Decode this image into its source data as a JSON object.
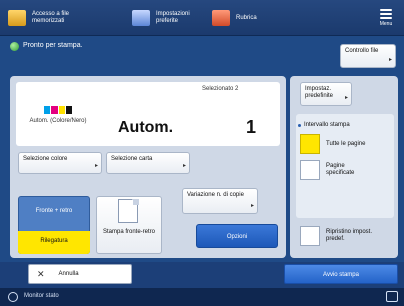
{
  "topbar": {
    "access_label": "Accesso a file memorizzati",
    "prefs_label": "Impostazioni preferite",
    "address_label": "Rubrica",
    "menu_label": "Menu"
  },
  "status": {
    "ready_text": "Pronto per stampa."
  },
  "controls": {
    "controllo_file": "Controllo file",
    "impost_predef": "Impostaz. predefinite",
    "selected_label": "Selezionato 2",
    "color_caption": "Autom. (Colore/Nero)",
    "color_mode_value": "Autom.",
    "copies_value": "1",
    "selezione_colore": "Selezione colore",
    "selezione_carta": "Selezione carta",
    "fronte_retro_top": "Fronte + retro",
    "fronte_retro_bottom": "Rilegatura",
    "stampa_fronte_retro": "Stampa fronte-retro",
    "variazione_copie": "Variazione n. di copie",
    "opzioni": "Opzioni"
  },
  "page_range": {
    "heading": "Intervallo stampa",
    "all_pages": "Tutte le pagine",
    "specified_pages": "Pagine specificate",
    "reset_defaults": "Ripristino impost. predef."
  },
  "bottom": {
    "annulla": "Annulla",
    "avvio_stampa": "Avvio stampa",
    "monitor": "Monitor stato"
  },
  "colors": {
    "accent_yellow": "#ffe600",
    "primary_blue": "#2463c8",
    "background_blue": "#1f4a86"
  }
}
